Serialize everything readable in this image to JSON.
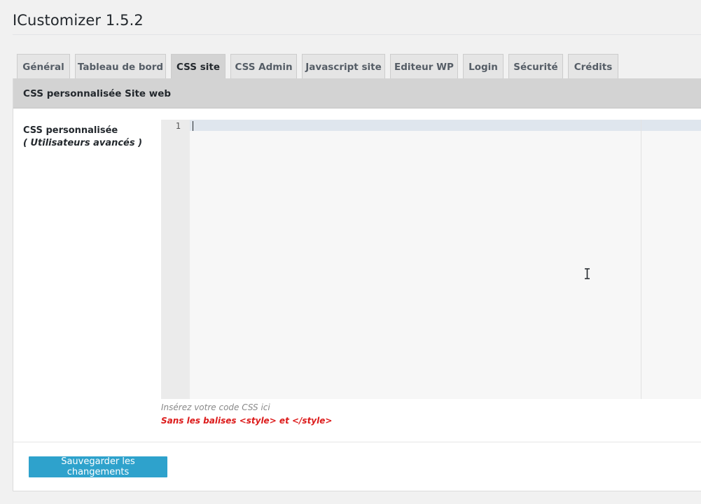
{
  "page": {
    "title": "ICustomizer 1.5.2"
  },
  "tabs": [
    {
      "label": "Général",
      "active": false
    },
    {
      "label": "Tableau de bord",
      "active": false
    },
    {
      "label": "CSS site",
      "active": true
    },
    {
      "label": "CSS Admin",
      "active": false
    },
    {
      "label": "Javascript site",
      "active": false
    },
    {
      "label": "Editeur WP",
      "active": false
    },
    {
      "label": "Login",
      "active": false
    },
    {
      "label": "Sécurité",
      "active": false
    },
    {
      "label": "Crédits",
      "active": false
    }
  ],
  "section": {
    "title": "CSS personnalisée Site web"
  },
  "field": {
    "label": "CSS personnalisée",
    "sublabel": "( Utilisateurs avancés )"
  },
  "editor": {
    "line_numbers": [
      "1"
    ],
    "content": ""
  },
  "help": {
    "hint": "Insérez votre code CSS ici",
    "warning": "Sans les balises <style> et </style>"
  },
  "actions": {
    "save_label": "Sauvegarder les changements"
  },
  "colors": {
    "accent": "#2ea2cc",
    "warning": "#dc1a1a",
    "tab_active": "#d3d3d3",
    "tab_inactive": "#e5e5e5"
  }
}
